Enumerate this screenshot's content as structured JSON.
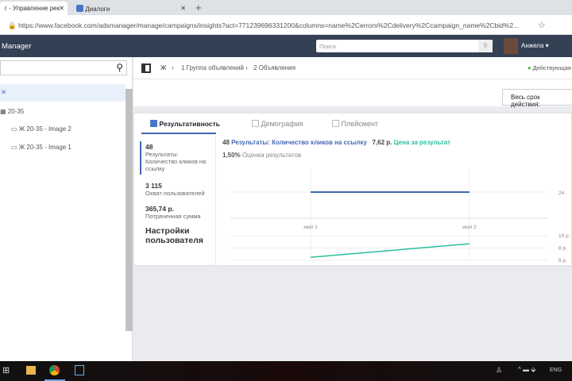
{
  "browser": {
    "tabs": [
      {
        "label": "г - Управление рек"
      },
      {
        "label": "Диалоги"
      }
    ],
    "new_tab": "+",
    "url": "https://www.facebook.com/adsmanager/manage/campaigns/insights?act=771239696331200&columns=name%2Cerrors%2Cdelivery%2Ccampaign_name%2Cbid%2..."
  },
  "header": {
    "title": "Manager",
    "search_placeholder": "Поиск",
    "user": "Анжела"
  },
  "sidebar": {
    "items": [
      {
        "label": "ж"
      },
      {
        "label": "20-35"
      },
      {
        "label": "Ж 20-35 - Image 2"
      },
      {
        "label": "Ж 20-35 - Image 1"
      }
    ]
  },
  "breadcrumb": {
    "items": [
      "Ж",
      "1 Группа объявлений",
      "2 Объявления"
    ],
    "status": "Действующая"
  },
  "date_button": "Весь срок действия:",
  "tabs": [
    {
      "label": "Результативность"
    },
    {
      "label": "Демография"
    },
    {
      "label": "Плейсмент"
    }
  ],
  "metrics": [
    {
      "value": "48",
      "label": "Результаты: Количество кликов на ссылку"
    },
    {
      "value": "3 115",
      "label": "Охват пользователей"
    },
    {
      "value": "365,74 р.",
      "label": "Потраченная сумма"
    }
  ],
  "custom_settings": "Настройки пользователя",
  "summary": {
    "results_value": "48",
    "results_label": "Результаты: Количество кликов на ссылку",
    "cost_value": "7,62 р.",
    "cost_label": "Цена за результат",
    "rate_value": "1,50%",
    "rate_label": "Оценка результатов"
  },
  "taskbar": {
    "lang": "ENG"
  },
  "chart_data": {
    "type": "line",
    "categories": [
      "июл 1",
      "июл 2"
    ],
    "series": [
      {
        "name": "Результаты",
        "values": [
          24,
          24
        ],
        "color": "#4267b2",
        "axis_ticks": [
          "24"
        ]
      },
      {
        "name": "Цена за результат",
        "values": [
          6.5,
          8.7
        ],
        "color": "#2bbf9f",
        "axis_ticks": [
          "10 р.",
          "8 р.",
          "6 р."
        ],
        "ylim": [
          6,
          10
        ]
      }
    ]
  }
}
